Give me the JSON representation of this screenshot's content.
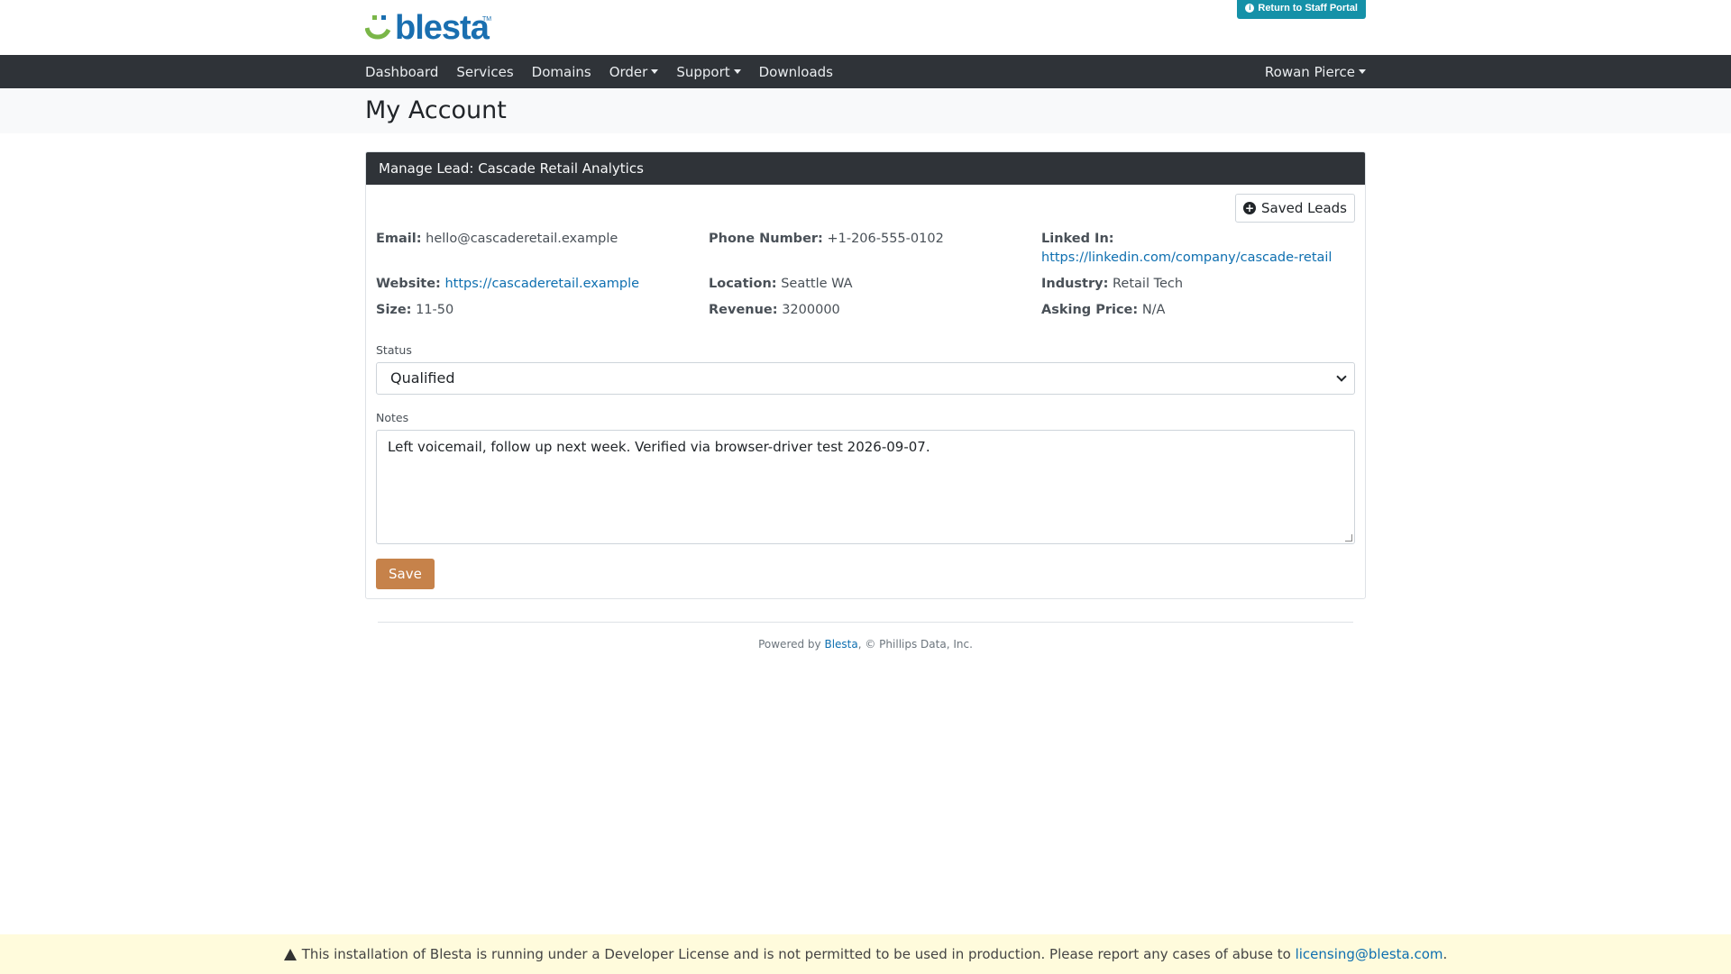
{
  "header": {
    "logo_text": "blesta",
    "logo_tm": "TM",
    "staff_portal_label": "Return to Staff Portal"
  },
  "nav": {
    "items": [
      {
        "label": "Dashboard",
        "dropdown": false
      },
      {
        "label": "Services",
        "dropdown": false
      },
      {
        "label": "Domains",
        "dropdown": false
      },
      {
        "label": "Order",
        "dropdown": true
      },
      {
        "label": "Support",
        "dropdown": true
      },
      {
        "label": "Downloads",
        "dropdown": false
      }
    ],
    "user": "Rowan Pierce"
  },
  "page_title": "My Account",
  "card": {
    "header": "Manage Lead: Cascade Retail Analytics",
    "saved_leads_label": "Saved Leads",
    "fields": {
      "email": {
        "label": "Email:",
        "value": "hello@cascaderetail.example"
      },
      "phone": {
        "label": "Phone Number:",
        "value": "+1-206-555-0102"
      },
      "linkedin": {
        "label": "Linked In:",
        "value": "https://linkedin.com/company/cascade-retail"
      },
      "website": {
        "label": "Website:",
        "value": "https://cascaderetail.example"
      },
      "location": {
        "label": "Location:",
        "value": "Seattle WA"
      },
      "industry": {
        "label": "Industry:",
        "value": "Retail Tech"
      },
      "size": {
        "label": "Size:",
        "value": "11-50"
      },
      "revenue": {
        "label": "Revenue:",
        "value": "3200000"
      },
      "asking_price": {
        "label": "Asking Price:",
        "value": "N/A"
      }
    },
    "status_label": "Status",
    "status_value": "Qualified",
    "notes_label": "Notes",
    "notes_value": "Left voicemail, follow up next week. Verified via browser-driver test 2026-09-07.",
    "save_label": "Save"
  },
  "footer": {
    "powered_prefix": "Powered by ",
    "powered_link": "Blesta",
    "powered_suffix": ", © Phillips Data, Inc."
  },
  "license_bar": {
    "text": "This installation of Blesta is running under a Developer License and is not permitted to be used in production. Please report any cases of abuse to ",
    "email": "licensing@blesta.com",
    "end": "."
  },
  "colors": {
    "nav_bg": "#2f3338",
    "accent_teal": "#1591a8",
    "save_button": "#c6824a",
    "link": "#0e6fb0",
    "logo_green": "#7ab648",
    "logo_blue": "#1a6fb0"
  }
}
